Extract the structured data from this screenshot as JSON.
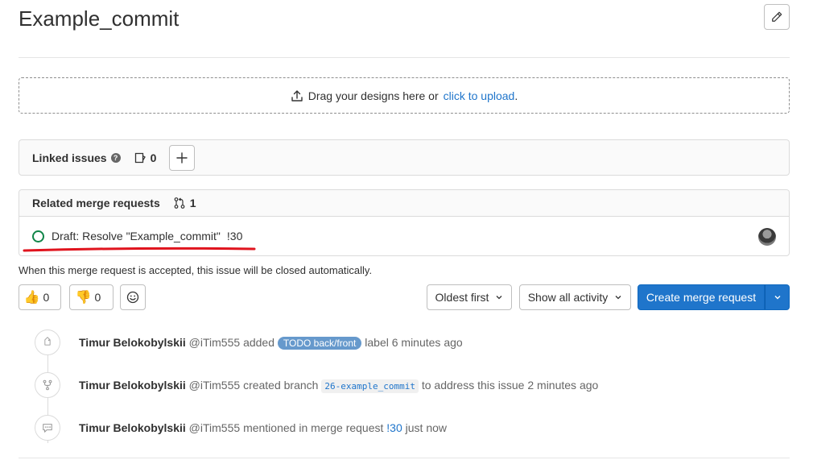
{
  "issue": {
    "title": "Example_commit"
  },
  "upload": {
    "text": "Drag your designs here or",
    "link": "click to upload",
    "suffix": "."
  },
  "linked_issues": {
    "label": "Linked issues",
    "help": "?",
    "count": "0"
  },
  "related_mrs": {
    "label": "Related merge requests",
    "count": "1",
    "items": [
      {
        "title": "Draft: Resolve \"Example_commit\"",
        "ref": "!30"
      }
    ]
  },
  "close_note": "When this merge request is accepted, this issue will be closed automatically.",
  "reactions": {
    "thumbs_up_count": "0",
    "thumbs_down_count": "0"
  },
  "controls": {
    "sort_label": "Oldest first",
    "filter_label": "Show all activity",
    "create_mr_label": "Create merge request"
  },
  "activity": [
    {
      "name": "Timur Belokobylskii",
      "handle": "@iTim555",
      "pre": "added",
      "label": "TODO back/front",
      "post": "label 6 minutes ago"
    },
    {
      "name": "Timur Belokobylskii",
      "handle": "@iTim555",
      "pre": "created branch",
      "branch": "26-example_commit",
      "post": "to address this issue 2 minutes ago"
    },
    {
      "name": "Timur Belokobylskii",
      "handle": "@iTim555",
      "pre": "mentioned in merge request",
      "ref": "!30",
      "post": "just now"
    }
  ],
  "colors": {
    "primary": "#1f75cb",
    "open": "#108548",
    "label": "#6699cc",
    "annotation": "#e0141e"
  }
}
